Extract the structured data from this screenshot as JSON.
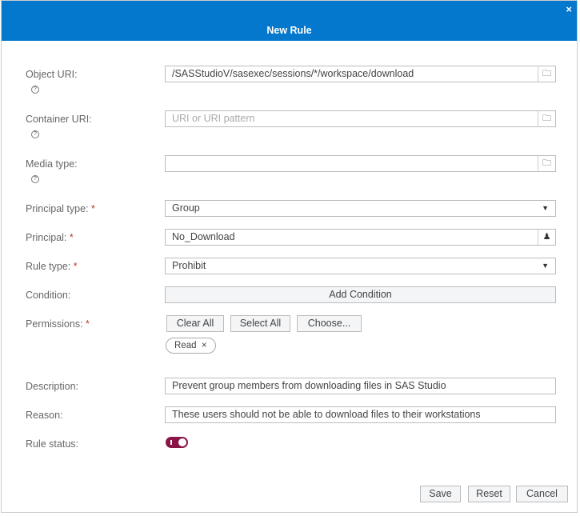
{
  "dialog": {
    "title": "New Rule",
    "close_label": "×"
  },
  "fields": {
    "object_uri": {
      "label": "Object URI:",
      "value": "/SASStudioV/sasexec/sessions/*/workspace/download",
      "icon": "folder-icon"
    },
    "container_uri": {
      "label": "Container URI:",
      "value": "",
      "placeholder": "URI or URI pattern",
      "icon": "folder-icon"
    },
    "media_type": {
      "label": "Media type:",
      "value": "",
      "icon": "folder-icon"
    },
    "principal_type": {
      "label": "Principal type:",
      "value": "Group"
    },
    "principal": {
      "label": "Principal:",
      "value": "No_Download",
      "icon": "person-icon"
    },
    "rule_type": {
      "label": "Rule type:",
      "value": "Prohibit"
    },
    "condition": {
      "label": "Condition:",
      "button": "Add Condition"
    },
    "permissions": {
      "label": "Permissions:",
      "clear_all": "Clear All",
      "select_all": "Select All",
      "choose": "Choose...",
      "chips": [
        {
          "label": "Read",
          "remove": "×"
        }
      ]
    },
    "description": {
      "label": "Description:",
      "value": "Prevent group members from downloading files in SAS Studio"
    },
    "reason": {
      "label": "Reason:",
      "value": "These users should not be able to download files to their workstations"
    },
    "rule_status": {
      "label": "Rule status:",
      "enabled": true
    }
  },
  "required_mark": "*",
  "help_mark": "?",
  "footer": {
    "save": "Save",
    "reset": "Reset",
    "cancel": "Cancel"
  },
  "colors": {
    "header": "#0378cd",
    "toggle": "#8a1546",
    "required": "#c0392b"
  }
}
